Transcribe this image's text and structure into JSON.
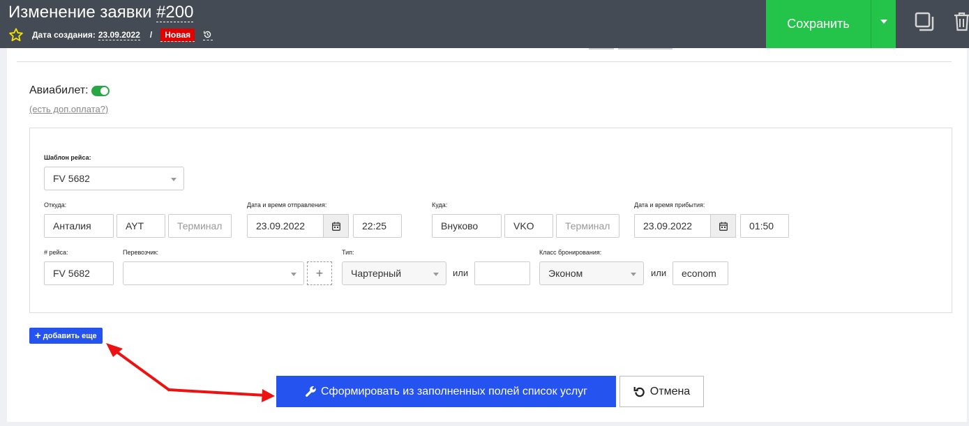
{
  "header": {
    "title_prefix": "Изменение заявки ",
    "title_number": "#200",
    "created_label": "Дата создания:",
    "created_value": "23.09.2022",
    "separator": "/",
    "status": "Новая",
    "save_label": "Сохранить",
    "icons": {
      "favorite": "star-icon",
      "history": "history-icon",
      "copy": "copy-icon",
      "delete": "trash-icon",
      "dropdown": "caret-down-icon"
    }
  },
  "colors": {
    "header_bg": "#454b55",
    "save_green": "#24c44a",
    "status_red": "#e00000",
    "primary_blue": "#2553f0",
    "toggle_green": "#28a745",
    "arrow_red": "#ee1111"
  },
  "avia": {
    "label": "Авиабилет:",
    "toggle_on": true,
    "extra_payment_link": "(есть доп.оплата?)"
  },
  "flight": {
    "template_label": "Шаблон рейса:",
    "template_value": "FV 5682",
    "from_label": "Откуда:",
    "from_city": "Анталия",
    "from_code": "AYT",
    "from_terminal_placeholder": "Терминал",
    "departure_label": "Дата и время отправления:",
    "departure_date": "23.09.2022",
    "departure_time": "22:25",
    "to_label": "Куда:",
    "to_city": "Внуково",
    "to_code": "VKO",
    "to_terminal_placeholder": "Терминал",
    "arrival_label": "Дата и время прибытия:",
    "arrival_date": "23.09.2022",
    "arrival_time": "01:50",
    "number_label": "# рейса:",
    "number_value": "FV 5682",
    "carrier_label": "Перевозчик:",
    "carrier_value": "",
    "add_carrier": "+",
    "type_label": "Тип:",
    "type_value": "Чартерный",
    "or_1": "или",
    "type_custom": "",
    "class_label": "Класс бронирования:",
    "class_value": "Эконом",
    "or_2": "или",
    "class_custom": "econom"
  },
  "actions": {
    "add_more": "добавить еще",
    "generate": "Сформировать из заполненных полей список услуг",
    "cancel": "Отмена"
  }
}
